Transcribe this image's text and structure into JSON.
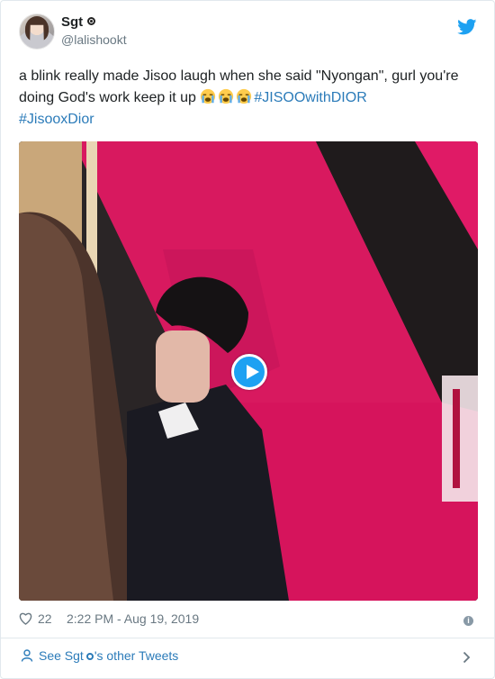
{
  "author": {
    "display_name": "Sgt",
    "handle": "@lalishookt"
  },
  "tweet": {
    "text_line": "a blink really made Jisoo laugh when she said \"Nyongan\", gurl you're doing God's work keep it up ",
    "emojis": [
      "loudly-crying-face",
      "loudly-crying-face",
      "loudly-crying-face"
    ],
    "hashtags": [
      "#JISOOwithDIOR",
      "#JisooxDior"
    ]
  },
  "media": {
    "type": "video",
    "play_icon": "play-icon"
  },
  "footer": {
    "likes": "22",
    "timestamp": "2:22 PM - Aug 19, 2019"
  },
  "see_more": {
    "prefix": "See Sgt",
    "suffix": "'s other Tweets"
  },
  "colors": {
    "link": "#2b7bb9",
    "twitter_blue": "#1da1f2",
    "muted": "#697882"
  }
}
